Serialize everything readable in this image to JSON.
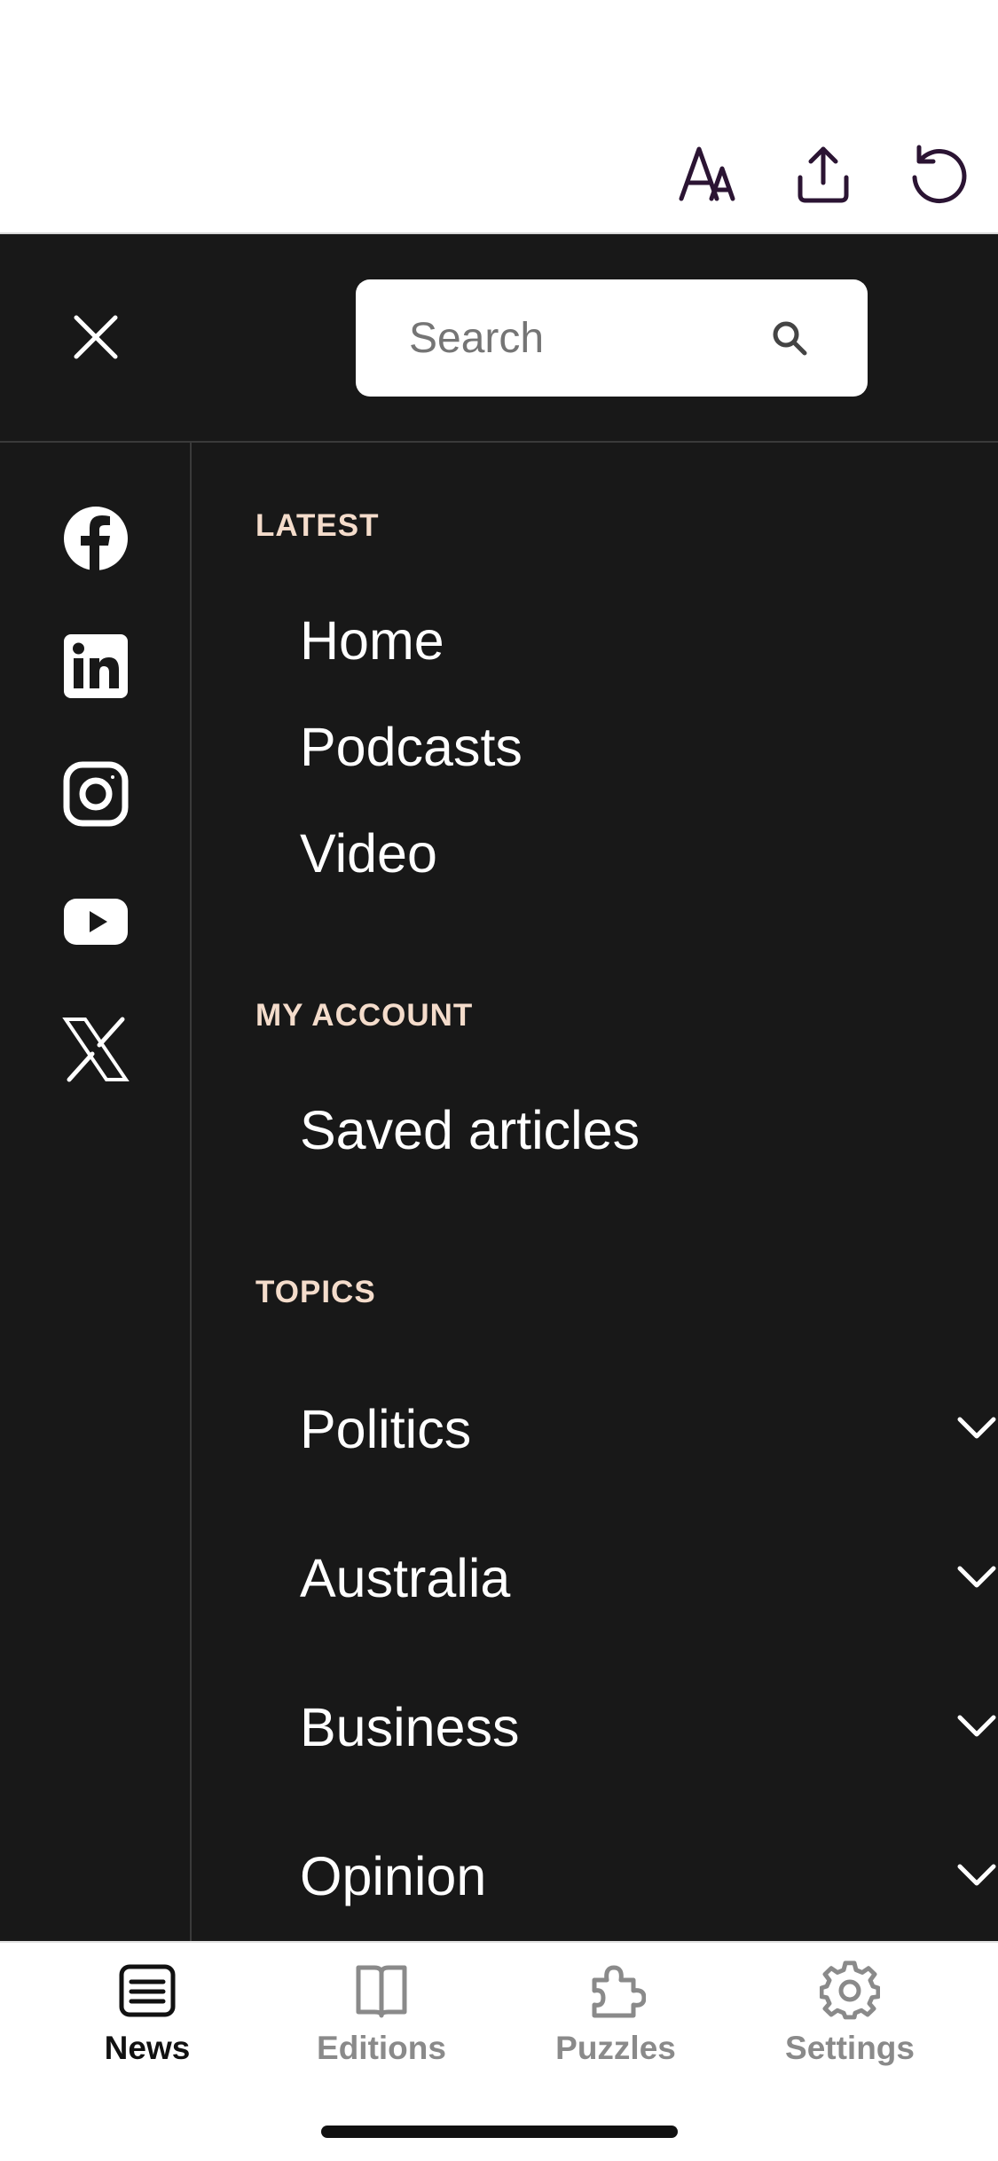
{
  "toolbar": {
    "icons": [
      "text-size-icon",
      "share-icon",
      "refresh-icon"
    ],
    "icon_color": "#2b1433"
  },
  "menu": {
    "search": {
      "placeholder": "Search"
    },
    "social": [
      "facebook-icon",
      "linkedin-icon",
      "instagram-icon",
      "youtube-icon",
      "x-icon"
    ],
    "sections": {
      "latest": {
        "label": "LATEST",
        "items": [
          "Home",
          "Podcasts",
          "Video"
        ]
      },
      "account": {
        "label": "MY ACCOUNT",
        "items": [
          "Saved articles"
        ]
      },
      "topics": {
        "label": "TOPICS",
        "items": [
          "Politics",
          "Australia",
          "Business",
          "Opinion"
        ]
      }
    },
    "colors": {
      "background": "#181818",
      "section_label": "#f4dccb",
      "text": "#ffffff"
    }
  },
  "tabs": [
    {
      "label": "News",
      "icon": "news-icon",
      "active": true
    },
    {
      "label": "Editions",
      "icon": "editions-icon",
      "active": false
    },
    {
      "label": "Puzzles",
      "icon": "puzzles-icon",
      "active": false
    },
    {
      "label": "Settings",
      "icon": "settings-icon",
      "active": false
    }
  ]
}
